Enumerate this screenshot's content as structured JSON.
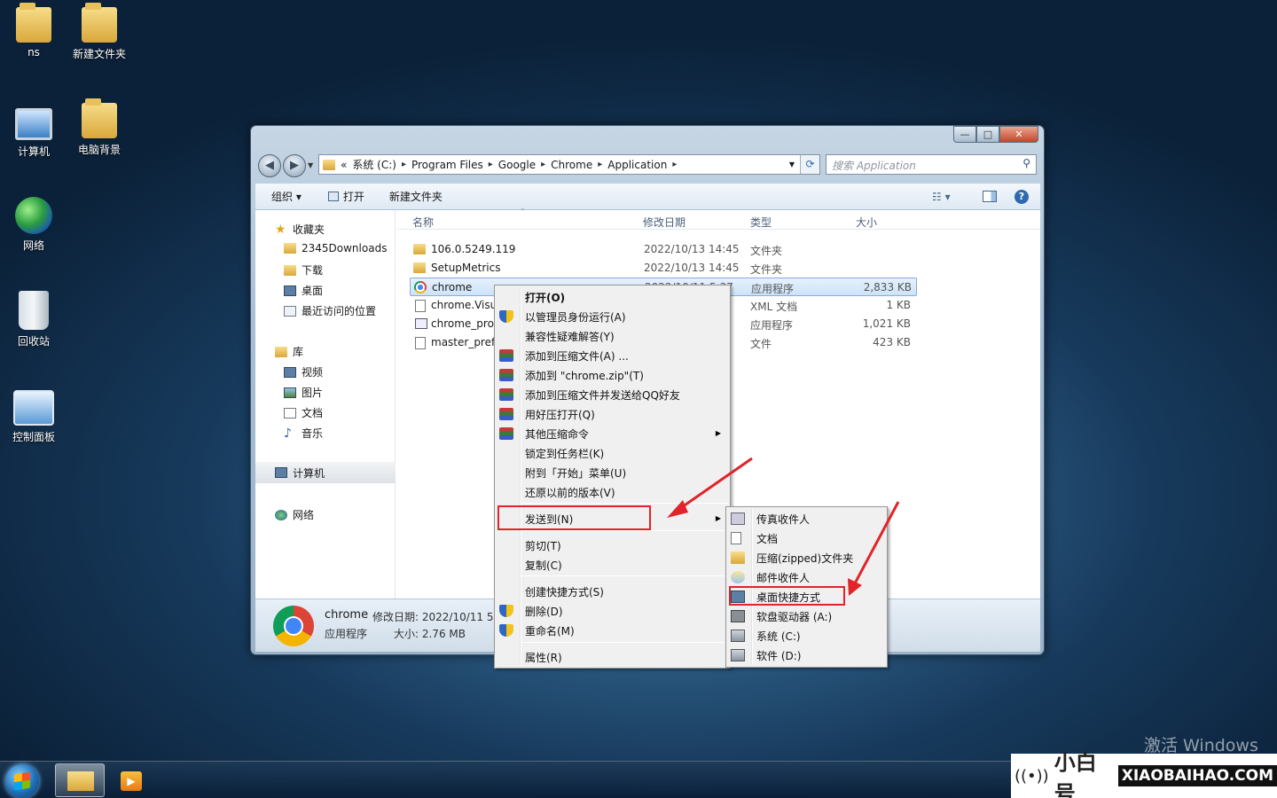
{
  "desktop": {
    "icons": [
      "ns",
      "新建文件夹",
      "计算机",
      "电脑背景",
      "网络",
      "回收站",
      "控制面板"
    ]
  },
  "window": {
    "address": {
      "root": "«",
      "parts": [
        "系统 (C:)",
        "Program Files",
        "Google",
        "Chrome",
        "Application"
      ]
    },
    "search_placeholder": "搜索 Application",
    "toolbar": {
      "organize": "组织 ▾",
      "open": "打开",
      "new_folder": "新建文件夹"
    },
    "nav": {
      "favorites": "收藏夹",
      "fav_items": [
        "2345Downloads",
        "下载",
        "桌面",
        "最近访问的位置"
      ],
      "libraries": "库",
      "lib_items": [
        "视频",
        "图片",
        "文档",
        "音乐"
      ],
      "computer": "计算机",
      "network": "网络"
    },
    "columns": {
      "name": "名称",
      "date": "修改日期",
      "type": "类型",
      "size": "大小"
    },
    "files": [
      {
        "name": "106.0.5249.119",
        "date": "2022/10/13 14:45",
        "type": "文件夹",
        "size": ""
      },
      {
        "name": "SetupMetrics",
        "date": "2022/10/13 14:45",
        "type": "文件夹",
        "size": ""
      },
      {
        "name": "chrome",
        "date": "2022/10/11 5:37",
        "type": "应用程序",
        "size": "2,833 KB"
      },
      {
        "name": "chrome.Visu",
        "date": "",
        "type": "XML 文档",
        "size": "1 KB"
      },
      {
        "name": "chrome_prox",
        "date": "",
        "type": "应用程序",
        "size": "1,021 KB"
      },
      {
        "name": "master_prefe",
        "date": "",
        "type": "文件",
        "size": "423 KB"
      }
    ],
    "details": {
      "name": "chrome",
      "date_label": "修改日期: 2022/10/11 5:3",
      "type": "应用程序",
      "size_label": "大小: 2.76 MB"
    }
  },
  "context_menu": {
    "items": [
      "打开(O)",
      "以管理员身份运行(A)",
      "兼容性疑难解答(Y)",
      "添加到压缩文件(A) ...",
      "添加到 \"chrome.zip\"(T)",
      "添加到压缩文件并发送给QQ好友",
      "用好压打开(Q)",
      "其他压缩命令",
      "锁定到任务栏(K)",
      "附到「开始」菜单(U)",
      "还原以前的版本(V)",
      "发送到(N)",
      "剪切(T)",
      "复制(C)",
      "创建快捷方式(S)",
      "删除(D)",
      "重命名(M)",
      "属性(R)"
    ]
  },
  "send_to_menu": {
    "items": [
      "传真收件人",
      "文档",
      "压缩(zipped)文件夹",
      "邮件收件人",
      "桌面快捷方式",
      "软盘驱动器 (A:)",
      "系统 (C:)",
      "软件 (D:)"
    ]
  },
  "overlay": {
    "activate": "激活 Windows",
    "brand_cn": "小白号",
    "brand_en": "XIAOBAIHAO.COM"
  },
  "colors": {
    "highlight": "#e0242a",
    "selection": "#cde3f8"
  }
}
